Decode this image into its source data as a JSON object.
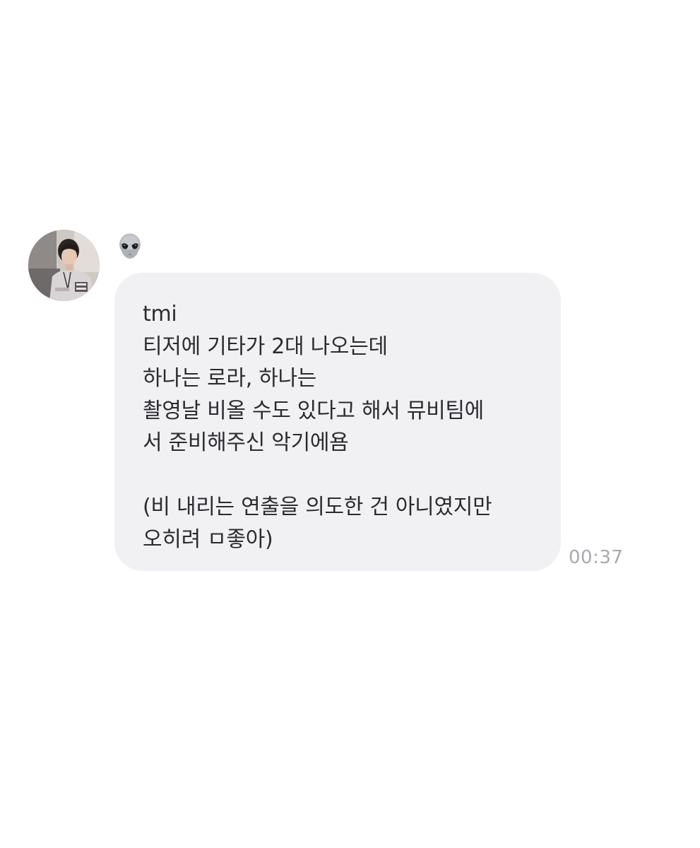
{
  "sender": {
    "avatar_icon": "profile-photo",
    "name_icon": "alien-emoji"
  },
  "message": {
    "lines": [
      "tmi",
      "티저에 기타가 2대 나오는데",
      "하나는 로라, 하나는",
      "촬영날 비올 수도 있다고 해서 뮤비팀에",
      "서 준비해주신 악기에욤",
      "",
      "(비 내리는 연출을 의도한 건 아니였지만",
      "오히려 ㅁ좋아)"
    ],
    "timestamp": "00:37"
  },
  "colors": {
    "bubble_bg": "#f1f1f4",
    "text": "#2b2b30",
    "timestamp": "#a9a9af"
  }
}
